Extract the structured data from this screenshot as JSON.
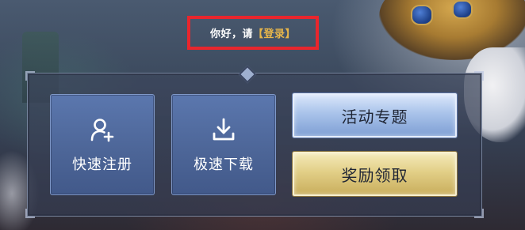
{
  "greeting": {
    "prefix": "你好，请",
    "login_link": "【登录】"
  },
  "buttons": {
    "register": {
      "label": "快速注册",
      "icon": "add-user-icon"
    },
    "download": {
      "label": "极速下载",
      "icon": "download-icon"
    },
    "events": {
      "label": "活动专题"
    },
    "rewards": {
      "label": "奖励领取"
    }
  },
  "colors": {
    "highlight_border": "#e8262d",
    "login_link": "#e8b64a",
    "blue_button": "#4d6698",
    "events_button": "#a9c3ea",
    "rewards_button": "#e2cf87"
  }
}
